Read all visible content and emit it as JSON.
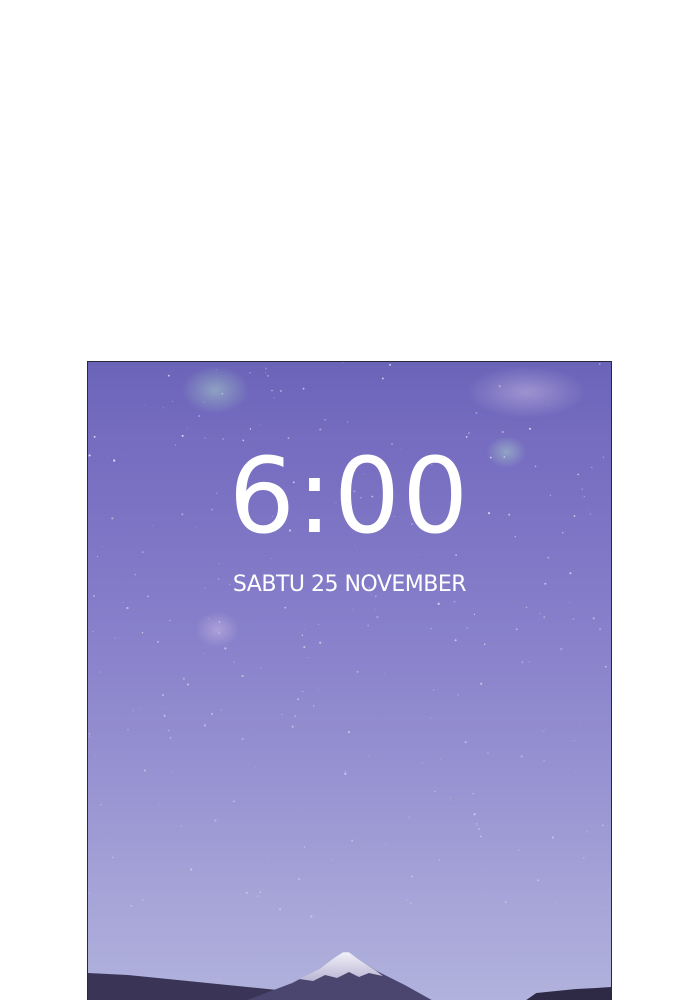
{
  "lockscreen": {
    "time": "6:00",
    "date": "SABTU 25 NOVEMBER"
  },
  "wallpaper": {
    "subject": "starry night sky over snow-capped mountain",
    "colors": {
      "sky_top": "#6a64b8",
      "sky_bottom": "#b1b2dd",
      "mountain": "#2a2740",
      "snow": "#e8e6f2"
    }
  }
}
